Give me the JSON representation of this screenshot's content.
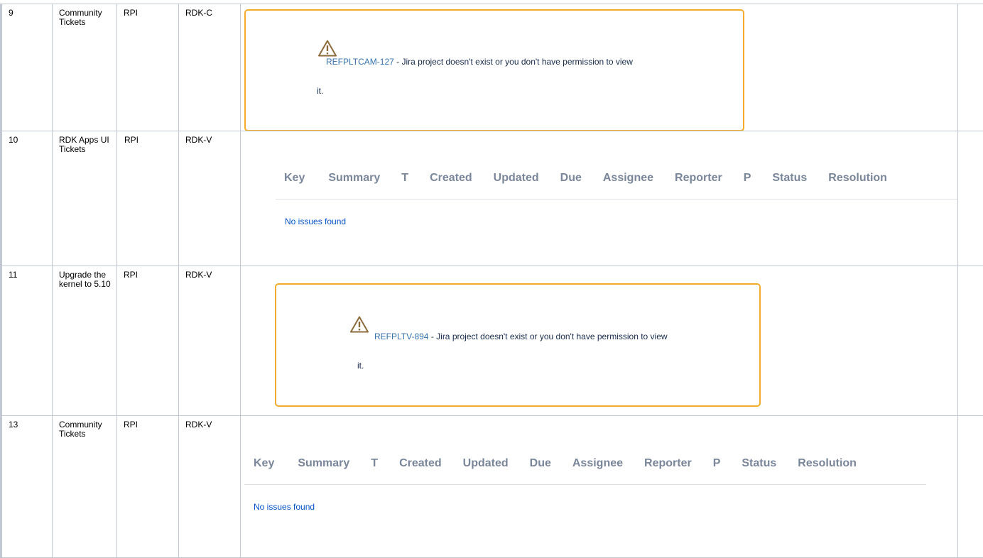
{
  "rows": [
    {
      "num": "9",
      "topic": "Community Tickets",
      "platform": "RPI",
      "profile": "RDK-C",
      "content": {
        "kind": "warning",
        "issue_key": "REFPLTCAM-127",
        "message": " - Jira project doesn't exist or you don't have permission to view",
        "message_tail": "it."
      }
    },
    {
      "num": "10",
      "topic": "RDK Apps UI Tickets",
      "platform": "RPI",
      "profile": "RDK-V",
      "content": {
        "kind": "jira-table",
        "empty_text": "No issues found"
      }
    },
    {
      "num": "11",
      "topic": "Upgrade the kernel to 5.10",
      "platform": "RPI",
      "profile": "RDK-V",
      "content": {
        "kind": "warning",
        "issue_key": "REFPLTV-894",
        "message": " - Jira project doesn't exist or you don't have permission to view",
        "message_tail": "it."
      }
    },
    {
      "num": "13",
      "topic": "Community Tickets",
      "platform": "RPI",
      "profile": "RDK-V",
      "content": {
        "kind": "jira-table",
        "empty_text": "No issues found"
      }
    }
  ],
  "jira_columns": [
    "Key",
    "Summary",
    "T",
    "Created",
    "Updated",
    "Due",
    "Assignee",
    "Reporter",
    "P",
    "Status",
    "Resolution"
  ],
  "colors": {
    "warning_border": "#f4ac2b",
    "link": "#3572b0",
    "column_header": "#7a869a",
    "empty_text": "#0052cc",
    "grid": "#c1c7d0"
  },
  "icons": {
    "warning": "warning-triangle-icon"
  }
}
